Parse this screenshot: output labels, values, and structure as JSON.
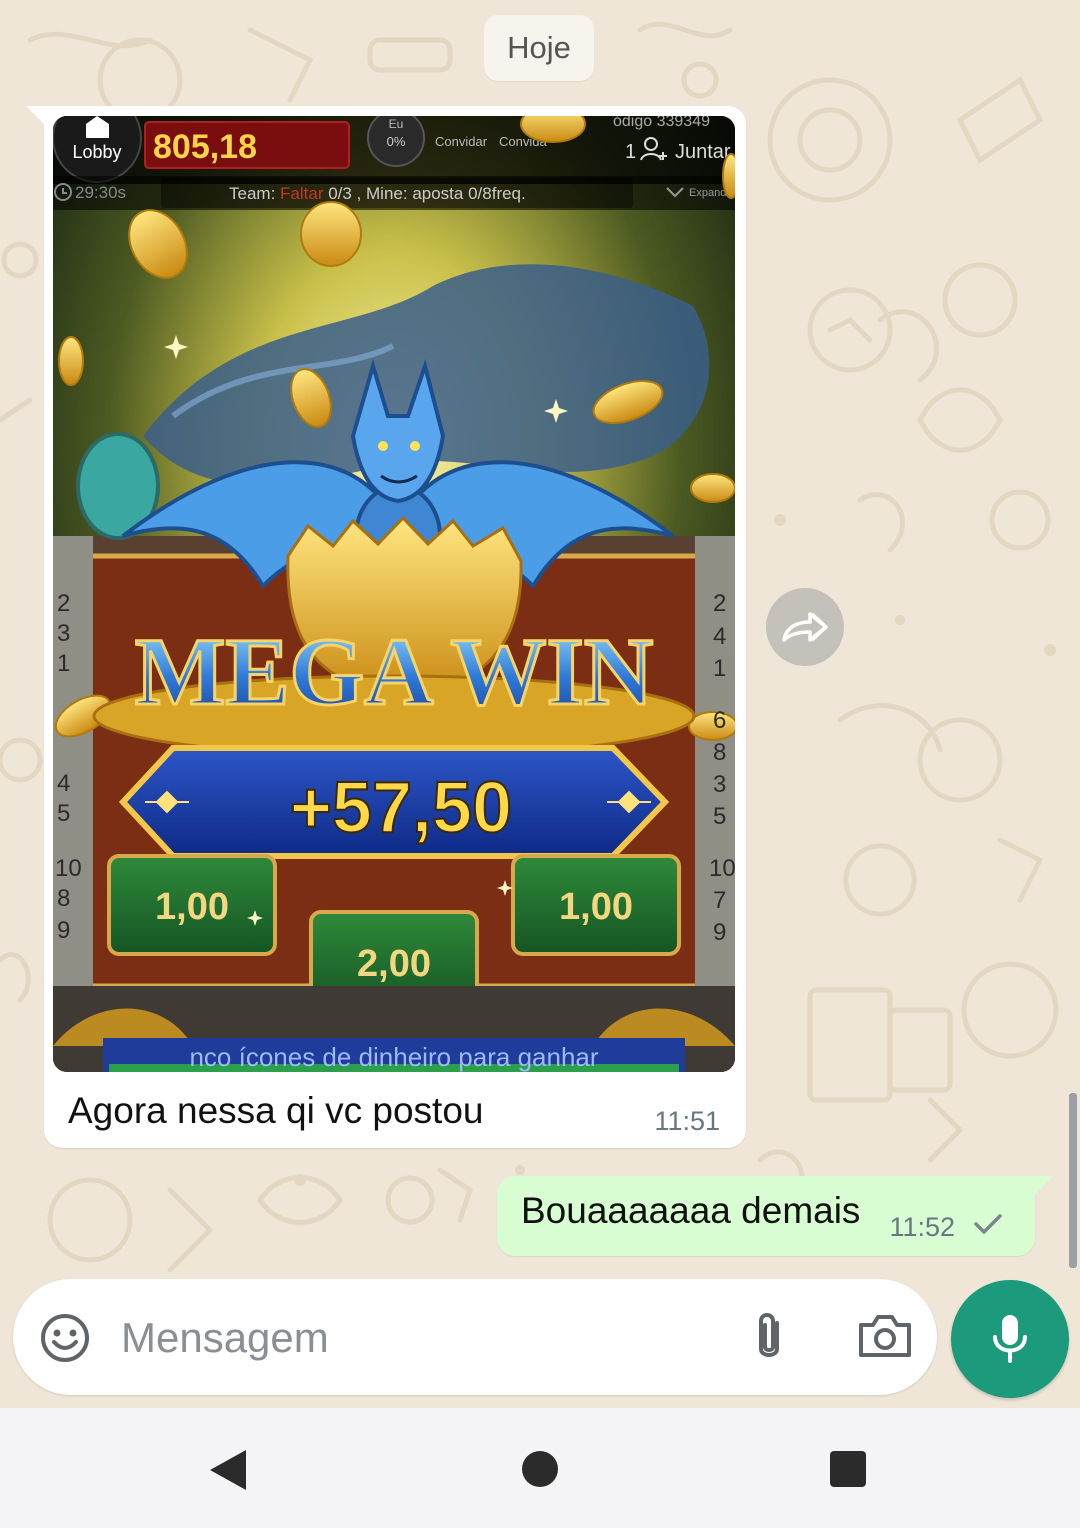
{
  "chat": {
    "day_separator": "Hoje",
    "incoming": {
      "caption": "Agora nessa qi vc postou",
      "time": "11:51",
      "image": {
        "lobby_label": "Lobby",
        "balance": "805,18",
        "eu_label": "Eu",
        "eu_percent": "0%",
        "invite_label": "Convidar",
        "invite_label_2": "Convida",
        "code_text": "ódigo 339349",
        "join_count": "1",
        "join_label": "Juntar",
        "timer": "29:30s",
        "team_prefix": "Team: ",
        "team_highlight": "Faltar",
        "team_suffix": " 0/3 , Mine: aposta 0/8freq.",
        "expand_label": "Expand",
        "headline": "MEGA WIN",
        "win_amount": "+57,50",
        "tile_left": "1,00",
        "tile_center": "2,00",
        "tile_right": "1,00",
        "left_column_numbers": [
          "2",
          "3",
          "1",
          "4",
          "5",
          "10",
          "8",
          "9"
        ],
        "right_column_numbers": [
          "2",
          "4",
          "1",
          "6",
          "8",
          "3",
          "5",
          "10",
          "7",
          "9"
        ],
        "footer_text": "nco ícones de dinheiro para ganhar"
      }
    },
    "outgoing": {
      "text": "Bouaaaaaaa demais",
      "time": "11:52",
      "status_icon": "single-check-icon"
    }
  },
  "composer": {
    "placeholder": "Mensagem",
    "emoji_icon": "smiley-icon",
    "attach_icon": "paperclip-icon",
    "camera_icon": "camera-icon",
    "mic_icon": "microphone-icon"
  },
  "colors": {
    "wallpaper": "#efe6d7",
    "outgoing_bubble": "#d9fdd3",
    "mic_button": "#1c9a7c",
    "win_gold": "#ffd84a"
  }
}
